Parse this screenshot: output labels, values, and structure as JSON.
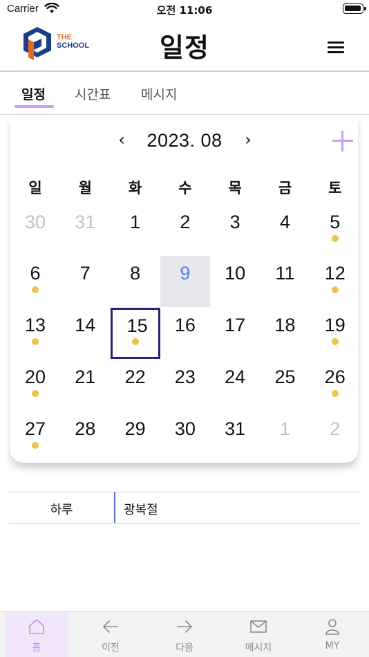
{
  "status_bar": {
    "carrier": "Carrier",
    "time": "오전 11:06"
  },
  "header": {
    "logo": {
      "line1": "THE",
      "line2": "SCHOOL"
    },
    "title": "일정"
  },
  "tabs": [
    {
      "label": "일정",
      "active": true
    },
    {
      "label": "시간표",
      "active": false
    },
    {
      "label": "메시지",
      "active": false
    }
  ],
  "calendar": {
    "month_label": "2023. 08",
    "prev_icon": "chevron-left",
    "next_icon": "chevron-right",
    "add_icon": "plus",
    "weekdays": [
      "일",
      "월",
      "화",
      "수",
      "목",
      "금",
      "토"
    ],
    "weeks": [
      [
        {
          "day": "30",
          "other": true
        },
        {
          "day": "31",
          "other": true
        },
        {
          "day": "1"
        },
        {
          "day": "2"
        },
        {
          "day": "3"
        },
        {
          "day": "4"
        },
        {
          "day": "5",
          "event": true
        }
      ],
      [
        {
          "day": "6",
          "event": true
        },
        {
          "day": "7"
        },
        {
          "day": "8"
        },
        {
          "day": "9",
          "today": true
        },
        {
          "day": "10"
        },
        {
          "day": "11"
        },
        {
          "day": "12",
          "event": true
        }
      ],
      [
        {
          "day": "13",
          "event": true
        },
        {
          "day": "14"
        },
        {
          "day": "15",
          "selected": true,
          "event": true
        },
        {
          "day": "16"
        },
        {
          "day": "17"
        },
        {
          "day": "18"
        },
        {
          "day": "19",
          "event": true
        }
      ],
      [
        {
          "day": "20",
          "event": true
        },
        {
          "day": "21"
        },
        {
          "day": "22"
        },
        {
          "day": "23"
        },
        {
          "day": "24"
        },
        {
          "day": "25"
        },
        {
          "day": "26",
          "event": true
        }
      ],
      [
        {
          "day": "27",
          "event": true
        },
        {
          "day": "28"
        },
        {
          "day": "29"
        },
        {
          "day": "30"
        },
        {
          "day": "31"
        },
        {
          "day": "1",
          "other": true
        },
        {
          "day": "2",
          "other": true
        }
      ]
    ]
  },
  "events": [
    {
      "type": "하루",
      "title": "광복절"
    }
  ],
  "bottom_nav": [
    {
      "label": "홈",
      "icon": "home-icon",
      "active": true
    },
    {
      "label": "이전",
      "icon": "arrow-left-icon",
      "active": false
    },
    {
      "label": "다음",
      "icon": "arrow-right-icon",
      "active": false
    },
    {
      "label": "메시지",
      "icon": "mail-icon",
      "active": false
    },
    {
      "label": "MY",
      "icon": "user-icon",
      "active": false
    }
  ],
  "colors": {
    "accent": "#c99df4",
    "today_bg": "#e6e8ee",
    "today_text": "#4a82f0",
    "selected_border": "#2b1f7a",
    "event_dot": "#e9c44a"
  }
}
